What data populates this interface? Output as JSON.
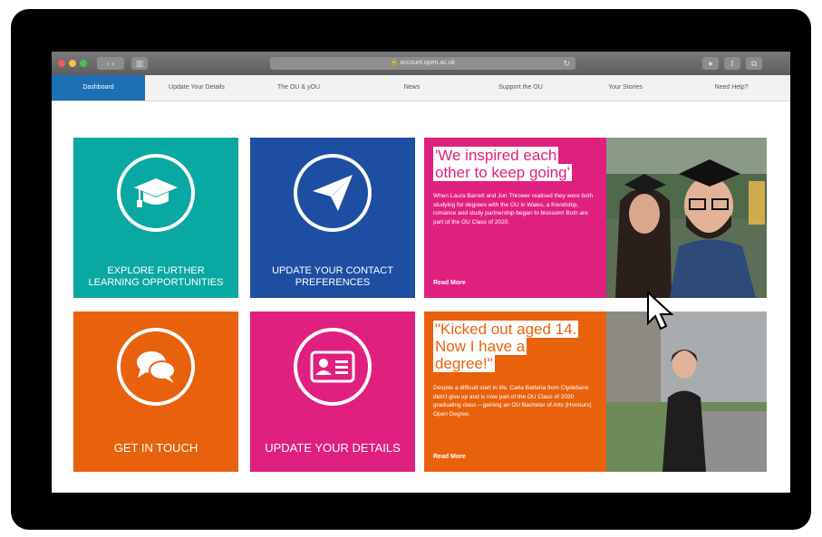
{
  "browser": {
    "address": "🔒 account.open.ac.uk"
  },
  "nav": {
    "tabs": [
      {
        "label": "Dashboard"
      },
      {
        "label": "Update Your Details"
      },
      {
        "label": "The OU & yOU"
      },
      {
        "label": "News"
      },
      {
        "label": "Support the OU"
      },
      {
        "label": "Your Stories"
      },
      {
        "label": "Need Help?"
      }
    ]
  },
  "tiles": {
    "explore": {
      "label": "EXPLORE FURTHER LEARNING OPPORTUNITIES",
      "color": "#0aa8a2",
      "icon": "graduation-cap-icon"
    },
    "contact": {
      "label": "UPDATE YOUR CONTACT PREFERENCES",
      "color": "#1e4ea2",
      "icon": "paper-plane-icon"
    },
    "touch": {
      "label": "GET IN TOUCH",
      "color": "#e8620e",
      "icon": "chat-bubbles-icon"
    },
    "details": {
      "label": "UPDATE YOUR DETAILS",
      "color": "#e0207f",
      "icon": "id-card-icon"
    }
  },
  "stories": {
    "first": {
      "headline_1": "'We inspired each",
      "headline_2": "other to keep going'",
      "body": "When Laura Barrett and Jon Thrower realised they were both studying for degrees with the OU in Wales, a friendship, romance and study partnership began to blossom! Both are part of the OU Class of 2020.",
      "more": "Read More",
      "color": "#e0207f"
    },
    "second": {
      "headline_1": "\"Kicked out aged 14.",
      "headline_2": "Now I have a",
      "headline_3": "degree!\"",
      "body": "Despite a difficult start in life, Carla Batteria from Clydebank didn't give up and is now part of the OU Class of 2020 graduating class – gaining an OU Bachelor of Arts (Honours) Open Degree.",
      "more": "Read More",
      "color": "#e8620e"
    }
  }
}
